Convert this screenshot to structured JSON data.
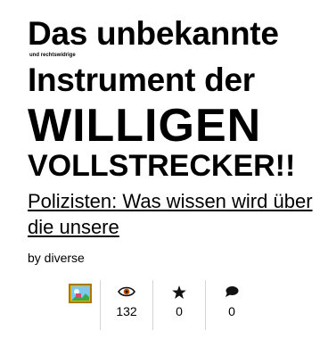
{
  "cover": {
    "line1": "Das unbekannte",
    "line_small": "und rechtswidrige",
    "line2": "Instrument der",
    "line3": "WILLIGEN",
    "line4": "VOLLSTRECKER!!"
  },
  "item": {
    "title": "Polizisten: Was wissen wird über die unsere",
    "byline": "by diverse"
  },
  "stats": {
    "views": {
      "icon": "eye-icon",
      "count": "132"
    },
    "favorites": {
      "icon": "star-icon",
      "count": "0"
    },
    "comments": {
      "icon": "speech-bubble-icon",
      "count": "0"
    }
  },
  "colors": {
    "thumbnail_frame": "#e8b500",
    "eye_accent": "#c85000",
    "separator": "#d4d4d4"
  }
}
